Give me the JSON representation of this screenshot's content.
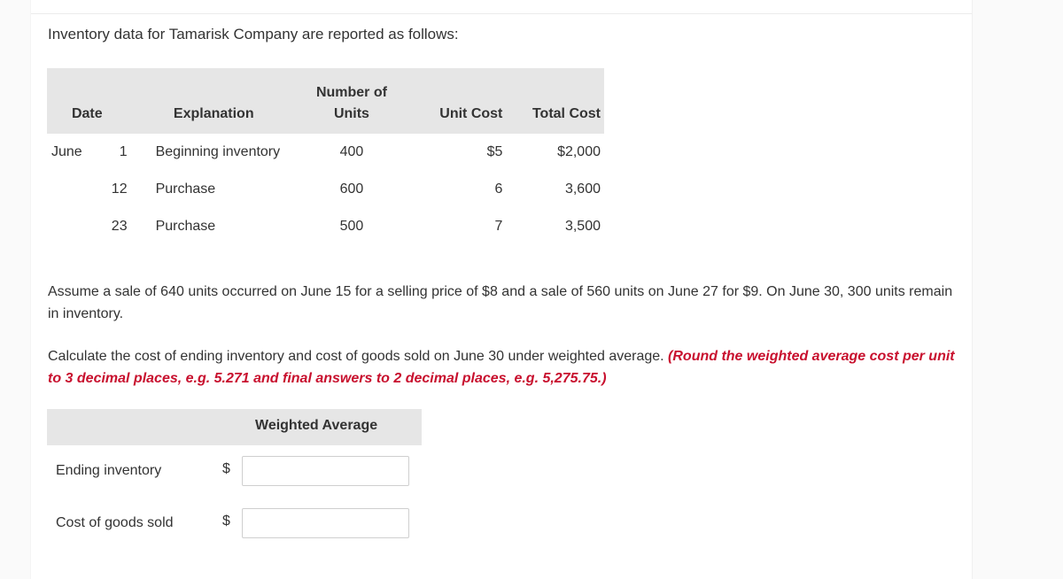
{
  "intro": "Inventory data for Tamarisk Company are reported as follows:",
  "table": {
    "headers": {
      "date": "Date",
      "explanation": "Explanation",
      "units_line1": "Number of",
      "units_line2": "Units",
      "unit_cost": "Unit Cost",
      "total_cost": "Total Cost"
    },
    "rows": [
      {
        "month": "June",
        "day": "1",
        "explanation": "Beginning inventory",
        "units": "400",
        "unit_cost": "$5",
        "total_cost": "$2,000"
      },
      {
        "month": "",
        "day": "12",
        "explanation": "Purchase",
        "units": "600",
        "unit_cost": "6",
        "total_cost": "3,600"
      },
      {
        "month": "",
        "day": "23",
        "explanation": "Purchase",
        "units": "500",
        "unit_cost": "7",
        "total_cost": "3,500"
      }
    ]
  },
  "paragraph1": "Assume a sale of 640 units occurred on June 15 for a selling price of $8 and a sale of 560 units on June 27 for $9. On June 30, 300 units remain in inventory.",
  "paragraph2_text": "Calculate the cost of ending inventory and cost of goods sold on June 30 under weighted average. ",
  "paragraph2_hint": "(Round the weighted average cost per unit to 3 decimal places, e.g. 5.271 and final answers to 2 decimal places, e.g. 5,275.75.)",
  "hint_color": "#c8102e",
  "answer": {
    "column_header": "Weighted Average",
    "rows": [
      {
        "label": "Ending inventory",
        "currency": "$",
        "value": ""
      },
      {
        "label": "Cost of goods sold",
        "currency": "$",
        "value": ""
      }
    ]
  }
}
